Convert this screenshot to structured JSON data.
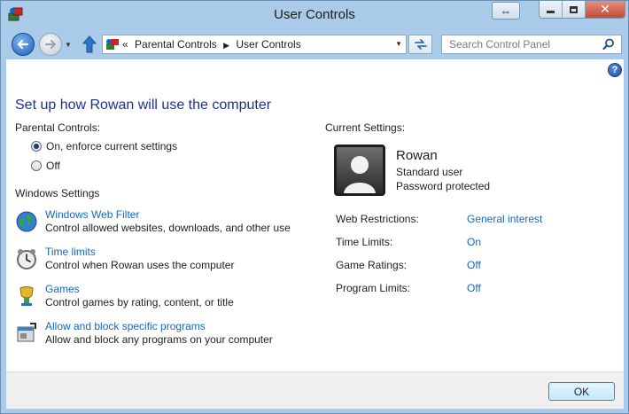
{
  "window": {
    "title": "User Controls"
  },
  "address": {
    "prefix": "«",
    "crumbs": [
      "Parental Controls",
      "User Controls"
    ]
  },
  "search": {
    "placeholder": "Search Control Panel"
  },
  "main": {
    "heading": "Set up how Rowan will use the computer",
    "parental_controls_label": "Parental Controls:",
    "options": [
      {
        "label": "On, enforce current settings",
        "checked": true
      },
      {
        "label": "Off",
        "checked": false
      }
    ],
    "windows_settings_label": "Windows Settings",
    "settings": [
      {
        "link": "Windows Web Filter",
        "desc": "Control allowed websites, downloads, and other use",
        "icon": "globe-icon"
      },
      {
        "link": "Time limits",
        "desc": "Control when Rowan uses the computer",
        "icon": "clock-icon"
      },
      {
        "link": "Games",
        "desc": "Control games by rating, content, or title",
        "icon": "game-icon"
      },
      {
        "link": "Allow and block specific programs",
        "desc": "Allow and block any programs on your computer",
        "icon": "program-icon"
      }
    ]
  },
  "current": {
    "label": "Current Settings:",
    "user": {
      "name": "Rowan",
      "type": "Standard user",
      "password": "Password protected"
    },
    "items": [
      {
        "label": "Web Restrictions:",
        "value": "General interest"
      },
      {
        "label": "Time Limits:",
        "value": "On"
      },
      {
        "label": "Game Ratings:",
        "value": "Off"
      },
      {
        "label": "Program Limits:",
        "value": "Off"
      }
    ]
  },
  "footer": {
    "ok_label": "OK"
  },
  "colors": {
    "link": "#1667be",
    "heading": "#1e3287",
    "frame": "#a9cbe9"
  }
}
